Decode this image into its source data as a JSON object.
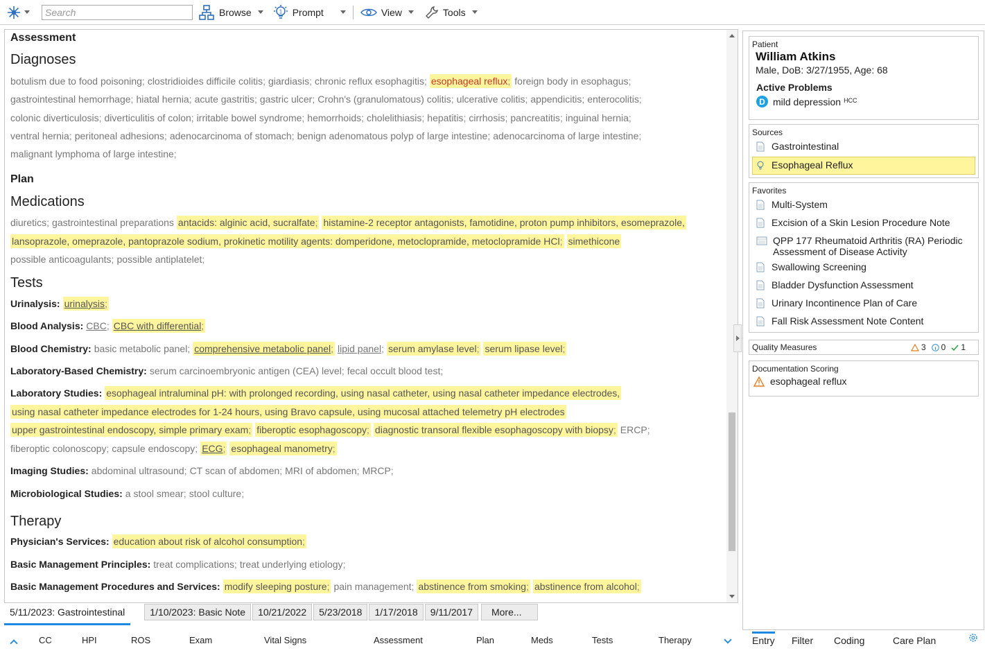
{
  "toolbar": {
    "search_placeholder": "Search",
    "browse_label": "Browse",
    "prompt_label": "Prompt",
    "view_label": "View",
    "tools_label": "Tools",
    "accent_color": "#2d6fc1"
  },
  "assessment": {
    "heading": "Assessment",
    "diagnoses_heading": "Diagnoses",
    "diagnoses_lines": [
      [
        {
          "t": "botulism due to food poisoning",
          "hl": false
        },
        {
          "t": "clostridioides difficile colitis",
          "hl": false
        },
        {
          "t": "giardiasis",
          "hl": false
        },
        {
          "t": "chronic reflux esophagitis",
          "hl": false
        },
        {
          "t": "esophageal reflux",
          "hl": true,
          "red": true
        },
        {
          "t": "foreign body in esophagus",
          "hl": false
        }
      ],
      [
        {
          "t": "gastrointestinal hemorrhage",
          "hl": false
        },
        {
          "t": "hiatal hernia",
          "hl": false
        },
        {
          "t": "acute gastritis",
          "hl": false
        },
        {
          "t": "gastric ulcer",
          "hl": false
        },
        {
          "t": "Crohn's (granulomatous) colitis",
          "hl": false
        },
        {
          "t": "ulcerative colitis",
          "hl": false
        },
        {
          "t": "appendicitis",
          "hl": false
        },
        {
          "t": "enterocolitis",
          "hl": false
        }
      ],
      [
        {
          "t": "colonic diverticulosis",
          "hl": false
        },
        {
          "t": "diverticulitis of colon",
          "hl": false
        },
        {
          "t": "irritable bowel syndrome",
          "hl": false
        },
        {
          "t": "hemorrhoids",
          "hl": false
        },
        {
          "t": "cholelithiasis",
          "hl": false
        },
        {
          "t": "hepatitis",
          "hl": false
        },
        {
          "t": "cirrhosis",
          "hl": false
        },
        {
          "t": "pancreatitis",
          "hl": false
        },
        {
          "t": "inguinal hernia",
          "hl": false
        }
      ],
      [
        {
          "t": "ventral hernia",
          "hl": false
        },
        {
          "t": "peritoneal adhesions",
          "hl": false
        },
        {
          "t": "adenocarcinoma of stomach",
          "hl": false
        },
        {
          "t": "benign adenomatous polyp of large intestine",
          "hl": false
        },
        {
          "t": "adenocarcinoma of large intestine",
          "hl": false
        }
      ],
      [
        {
          "t": "malignant lymphoma of large intestine",
          "hl": false
        }
      ]
    ]
  },
  "plan": {
    "heading": "Plan",
    "medications_heading": "Medications",
    "medications_lines": [
      [
        {
          "t": "diuretics",
          "hl": false
        },
        {
          "t": "gastrointestinal preparations",
          "hl": false,
          "nosep": true
        },
        {
          "t": "antacids: alginic acid, sucralfate",
          "hl": true
        },
        {
          "t": "histamine-2 receptor antagonists, famotidine, proton pump inhibitors, esomeprazole,",
          "hl": true,
          "nosep": true
        }
      ],
      [
        {
          "t": "lansoprazole, omeprazole, pantoprazole sodium, prokinetic motility agents: domperidone, metoclopramide, metoclopramide HCl",
          "hl": true
        },
        {
          "t": "simethicone",
          "hl": true,
          "nosep": true
        }
      ],
      [
        {
          "t": "possible anticoagulants",
          "hl": false
        },
        {
          "t": "possible antiplatelet",
          "hl": false
        }
      ]
    ],
    "tests_heading": "Tests",
    "tests_rows": [
      {
        "label": "Urinalysis:",
        "lines": [
          [
            {
              "t": "urinalysis",
              "hl": true,
              "ul": true
            }
          ]
        ]
      },
      {
        "label": "Blood Analysis:",
        "lines": [
          [
            {
              "t": "CBC",
              "hl": false,
              "ul": true
            },
            {
              "t": "CBC with differential",
              "hl": true,
              "ul": true
            }
          ]
        ]
      },
      {
        "label": "Blood Chemistry:",
        "lines": [
          [
            {
              "t": "basic metabolic panel",
              "hl": false
            },
            {
              "t": "comprehensive metabolic panel",
              "hl": true,
              "ul": true
            },
            {
              "t": "lipid panel",
              "hl": false,
              "ul": true
            },
            {
              "t": "serum amylase level",
              "hl": true
            },
            {
              "t": "serum lipase level",
              "hl": true
            }
          ]
        ]
      },
      {
        "label": "Laboratory-Based Chemistry:",
        "lines": [
          [
            {
              "t": "serum carcinoembryonic antigen (CEA) level",
              "hl": false
            },
            {
              "t": "fecal occult blood test",
              "hl": false
            }
          ]
        ]
      },
      {
        "label": "Laboratory Studies:",
        "lines": [
          [
            {
              "t": "esophageal intraluminal pH: with prolonged recording, using nasal catheter, using nasal catheter impedance electrodes,",
              "hl": true,
              "nosep": true
            }
          ],
          [
            {
              "t": "using nasal catheter impedance electrodes for 1-24 hours, using Bravo capsule, using mucosal attached telemetry pH electrodes",
              "hl": true,
              "nosep": true
            }
          ],
          [
            {
              "t": "upper gastrointestinal endoscopy, simple primary exam",
              "hl": true
            },
            {
              "t": "fiberoptic esophagoscopy",
              "hl": true
            },
            {
              "t": "diagnostic transoral flexible esophagoscopy with biopsy",
              "hl": true
            },
            {
              "t": "ERCP",
              "hl": false
            }
          ],
          [
            {
              "t": "fiberoptic colonoscopy",
              "hl": false
            },
            {
              "t": "capsule endoscopy",
              "hl": false
            },
            {
              "t": "ECG",
              "hl": true,
              "ul": true
            },
            {
              "t": "esophageal manometry",
              "hl": true
            }
          ]
        ]
      },
      {
        "label": "Imaging Studies:",
        "lines": [
          [
            {
              "t": "abdominal ultrasound",
              "hl": false
            },
            {
              "t": "CT scan of abdomen",
              "hl": false
            },
            {
              "t": "MRI of abdomen",
              "hl": false
            },
            {
              "t": "MRCP",
              "hl": false
            }
          ]
        ]
      },
      {
        "label": "Microbiological Studies:",
        "lines": [
          [
            {
              "t": "a stool smear",
              "hl": false
            },
            {
              "t": "stool culture",
              "hl": false
            }
          ]
        ]
      }
    ],
    "therapy_heading": "Therapy",
    "therapy_rows": [
      {
        "label": "Physician's Services:",
        "lines": [
          [
            {
              "t": "education about risk of alcohol consumption",
              "hl": true
            }
          ]
        ]
      },
      {
        "label": "Basic Management Principles:",
        "lines": [
          [
            {
              "t": "treat complications",
              "hl": false
            },
            {
              "t": "treat underlying etiology",
              "hl": false
            }
          ]
        ]
      },
      {
        "label": "Basic Management Procedures and Services:",
        "lines": [
          [
            {
              "t": "modify sleeping posture",
              "hl": true
            },
            {
              "t": "pain management",
              "hl": false
            },
            {
              "t": "abstinence from smoking",
              "hl": true
            },
            {
              "t": "abstinence from alcohol",
              "hl": true
            }
          ]
        ]
      }
    ]
  },
  "doc_tabs": {
    "active": "5/11/2023: Gastrointestinal",
    "others": [
      "1/10/2023: Basic Note",
      "10/21/2022",
      "5/23/2018",
      "1/17/2018",
      "9/11/2017",
      "More..."
    ]
  },
  "bottom_nav": [
    "CC",
    "HPI",
    "ROS",
    "Exam",
    "Vital Signs",
    "Assessment",
    "Plan",
    "Meds",
    "Tests",
    "Therapy"
  ],
  "patient": {
    "card_title": "Patient",
    "name": "William Atkins",
    "info": "Male, DoB: 3/27/1955, Age: 68",
    "active_problems_label": "Active Problems",
    "problem_badge": "D",
    "problem": "mild depression",
    "problem_sup": "HCC"
  },
  "sources": {
    "card_title": "Sources",
    "items": [
      "Gastrointestinal",
      "Esophageal Reflux"
    ]
  },
  "favorites": {
    "card_title": "Favorites",
    "items": [
      "Multi-System",
      "Excision of a Skin Lesion Procedure Note",
      "QPP 177 Rheumatoid Arthritis (RA) Periodic Assessment of Disease Activity",
      "Swallowing Screening",
      "Bladder Dysfunction Assessment",
      "Urinary Incontinence Plan of Care",
      "Fall Risk Assessment Note Content"
    ]
  },
  "quality_measures": {
    "label": "Quality Measures",
    "warn_count": "3",
    "info_count": "0",
    "ok_count": "1"
  },
  "documentation_scoring": {
    "card_title": "Documentation Scoring",
    "item": "esophageal reflux"
  },
  "right_tabs": [
    "Entry",
    "Filter",
    "Coding",
    "Care Plan"
  ],
  "colors": {
    "highlight": "#fff59d",
    "accent_blue": "#1e88e5",
    "warning": "#e67e22",
    "red_text": "#c0392b"
  }
}
